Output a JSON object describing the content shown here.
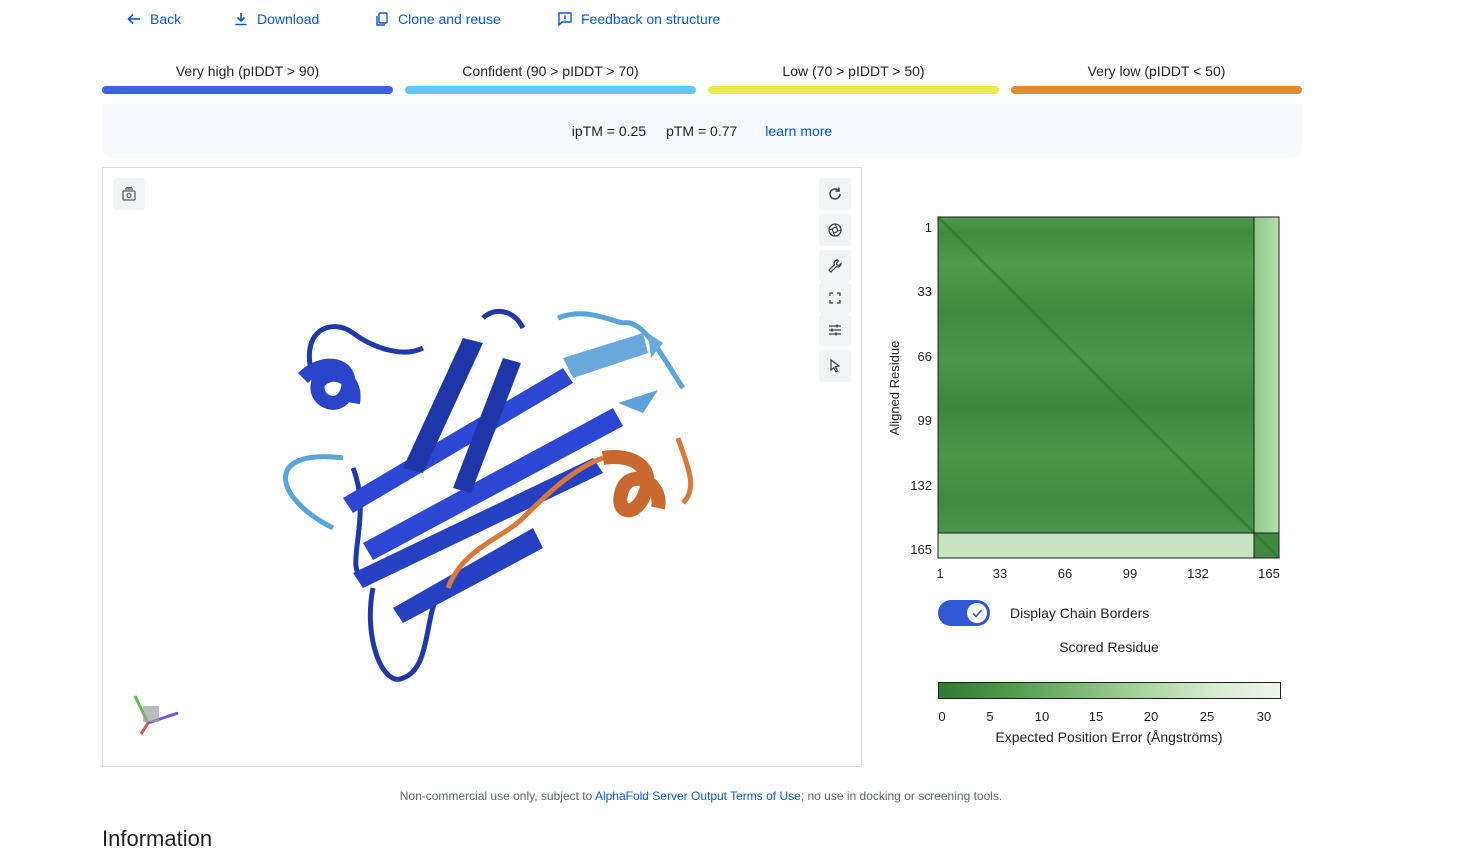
{
  "toolbar": {
    "back": "Back",
    "download": "Download",
    "clone": "Clone and reuse",
    "feedback": "Feedback on structure"
  },
  "plddt_legend": [
    {
      "label": "Very high (pIDDT > 90)",
      "color": "#3b63e6"
    },
    {
      "label": "Confident (90 > pIDDT > 70)",
      "color": "#63c7f0"
    },
    {
      "label": "Low (70 > pIDDT > 50)",
      "color": "#ede94a"
    },
    {
      "label": "Very low (pIDDT < 50)",
      "color": "#e48a35"
    }
  ],
  "metrics": {
    "iptm": "ipTM = 0.25",
    "ptm": "pTM = 0.77",
    "learn_more": "learn more"
  },
  "viewer": {
    "left_icon": "screenshot-icon",
    "right_icons": [
      "rotate-icon",
      "aperture-icon",
      "wrench-icon",
      "fullscreen-icon",
      "sliders-icon",
      "pointer-icon"
    ]
  },
  "pae": {
    "y_axis_label": "Aligned Residue",
    "y_ticks": [
      "1",
      "33",
      "66",
      "99",
      "132",
      "165"
    ],
    "x_ticks": [
      "1",
      "33",
      "66",
      "99",
      "132",
      "165"
    ],
    "toggle_label": "Display Chain Borders",
    "toggle_on": true,
    "x_axis_label": "Scored Residue",
    "colorbar_ticks": [
      "0",
      "5",
      "10",
      "15",
      "20",
      "25",
      "30"
    ],
    "colorbar_label": "Expected Position Error (Ångströms)",
    "colors": {
      "low_error": "#2e7a30",
      "high_error": "#eef6ea"
    }
  },
  "footer": {
    "prefix": "Non-commercial use only, subject to ",
    "link": "AlphaFold Server Output Terms of Use",
    "suffix": "; no use in docking or screening tools."
  },
  "section_title": "Information"
}
